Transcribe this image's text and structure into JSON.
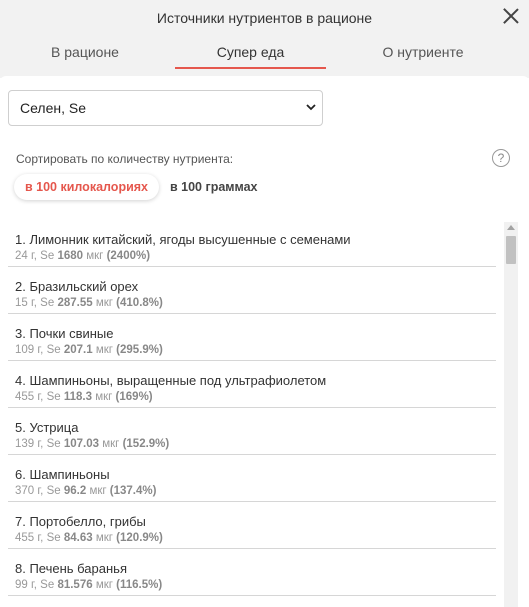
{
  "header": {
    "title": "Источники нутриентов в рационе",
    "tabs": [
      {
        "label": "В рационе",
        "active": false
      },
      {
        "label": "Супер еда",
        "active": true
      },
      {
        "label": "О нутриенте",
        "active": false
      }
    ]
  },
  "nutrient_select": {
    "value": "Селен, Se"
  },
  "sort": {
    "label": "Сортировать по количеству нутриента:",
    "options": [
      "в 100 килокалориях",
      "в 100 граммах"
    ],
    "selected": "в 100 килокалориях",
    "help_label": "?"
  },
  "foods": [
    {
      "name": "1. Лимонник китайский, ягоды высушенные с семенами",
      "meta_prefix": "24 г, Se",
      "amount": "1680",
      "unit": "мкг",
      "percent": "(2400%)"
    },
    {
      "name": "2. Бразильский орех",
      "meta_prefix": "15 г, Se",
      "amount": "287.55",
      "unit": "мкг",
      "percent": "(410.8%)"
    },
    {
      "name": "3. Почки свиные",
      "meta_prefix": "109 г, Se",
      "amount": "207.1",
      "unit": "мкг",
      "percent": "(295.9%)"
    },
    {
      "name": "4. Шампиньоны, выращенные под ультрафиолетом",
      "meta_prefix": "455 г, Se",
      "amount": "118.3",
      "unit": "мкг",
      "percent": "(169%)"
    },
    {
      "name": "5. Устрица",
      "meta_prefix": "139 г, Se",
      "amount": "107.03",
      "unit": "мкг",
      "percent": "(152.9%)"
    },
    {
      "name": "6. Шампиньоны",
      "meta_prefix": "370 г, Se",
      "amount": "96.2",
      "unit": "мкг",
      "percent": "(137.4%)"
    },
    {
      "name": "7. Портобелло, грибы",
      "meta_prefix": "455 г, Se",
      "amount": "84.63",
      "unit": "мкг",
      "percent": "(120.9%)"
    },
    {
      "name": "8. Печень баранья",
      "meta_prefix": "99 г, Se",
      "amount": "81.576",
      "unit": "мкг",
      "percent": "(116.5%)"
    }
  ],
  "colors": {
    "accent": "#e5574d",
    "header_bg": "#f2f2f2",
    "divider": "#d6d6d6"
  }
}
